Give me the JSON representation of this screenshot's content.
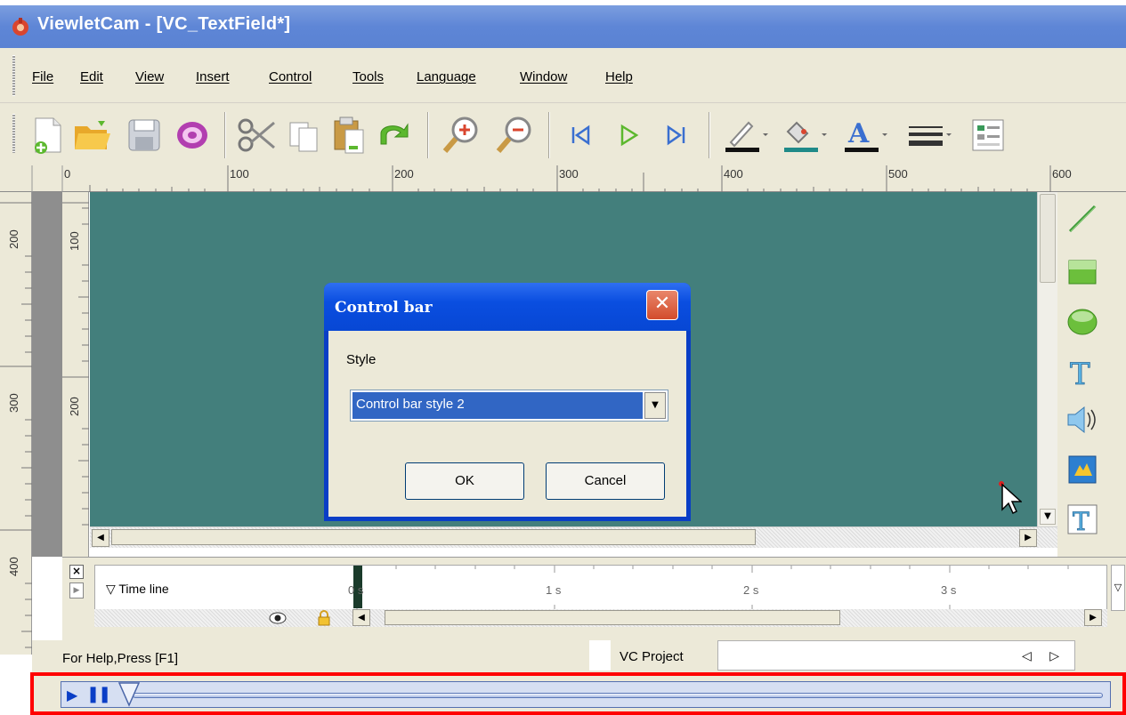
{
  "window": {
    "title": "ViewletCam - [VC_TextField*]",
    "icon": "viewletcam-app-icon"
  },
  "menu": {
    "items": [
      "File",
      "Edit",
      "View",
      "Insert",
      "Control",
      "Tools",
      "Language",
      "Window",
      "Help"
    ]
  },
  "toolbar": {
    "buttons": [
      "new-icon",
      "open-icon",
      "save-icon",
      "publish-icon",
      "cut-icon",
      "copy-icon",
      "paste-icon",
      "undo-icon",
      "zoom-in-icon",
      "zoom-out-icon",
      "first-frame-icon",
      "play-icon",
      "last-frame-icon",
      "line-color-icon",
      "fill-color-icon",
      "font-color-icon",
      "line-style-icon",
      "properties-icon"
    ]
  },
  "rulers": {
    "horizontal": [
      "0",
      "100",
      "200",
      "300",
      "400",
      "500",
      "600"
    ],
    "vertical_outer": [
      "200",
      "300",
      "400"
    ],
    "vertical_inner": [
      "100",
      "200"
    ]
  },
  "canvas": {
    "background": "#437f7c"
  },
  "palette": {
    "tools": [
      "line-tool-icon",
      "rectangle-tool-icon",
      "ellipse-tool-icon",
      "text-tool-icon",
      "sound-tool-icon",
      "image-tool-icon",
      "textfield-tool-icon"
    ]
  },
  "dialog": {
    "title": "Control bar",
    "style_label": "Style",
    "style_value": "Control bar style 2",
    "ok_label": "OK",
    "cancel_label": "Cancel",
    "close_glyph": "✕"
  },
  "timeline": {
    "label": "▽ Time line",
    "marks": [
      "0 s",
      "1 s",
      "2 s",
      "3 s"
    ]
  },
  "status": {
    "help_text": "For Help,Press [F1]",
    "project_label": "VC Project",
    "nav": "◁ ▷"
  },
  "control_bar": {
    "play_glyph": "▶",
    "pause_glyph": "❚❚",
    "highlight_color": "#ff0000"
  }
}
